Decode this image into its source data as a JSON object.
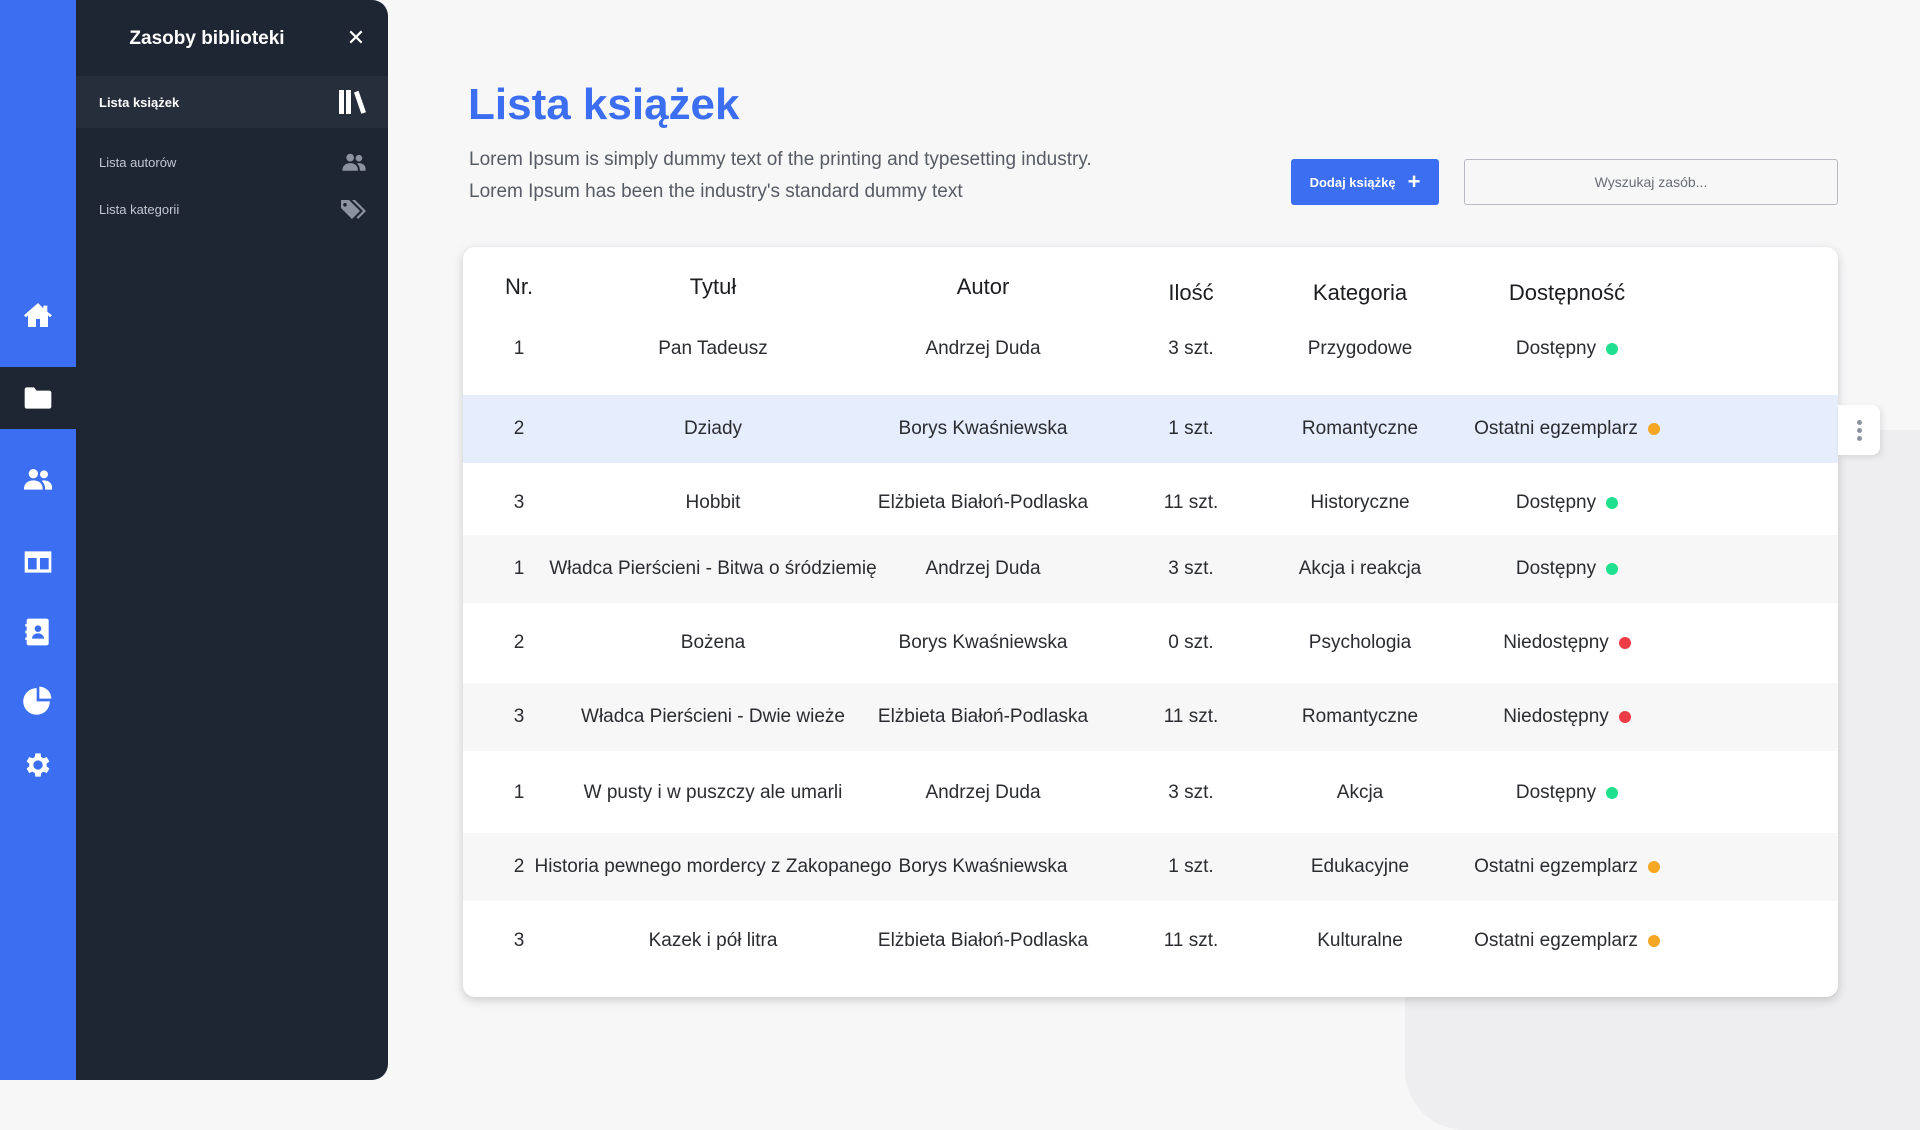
{
  "panel": {
    "title": "Zasoby biblioteki",
    "close_icon": "close-icon",
    "items": [
      {
        "label": "Lista książek",
        "icon": "books-icon",
        "active": true
      },
      {
        "label": "Lista autorów",
        "icon": "users-icon",
        "active": false
      },
      {
        "label": "Lista kategorii",
        "icon": "tags-icon",
        "active": false
      }
    ]
  },
  "rail": {
    "items": [
      {
        "icon": "home-icon",
        "active": false
      },
      {
        "icon": "folder-icon",
        "active": true
      },
      {
        "icon": "users-icon",
        "active": false
      },
      {
        "icon": "layout-icon",
        "active": false
      },
      {
        "icon": "contact-book-icon",
        "active": false
      },
      {
        "icon": "pie-chart-icon",
        "active": false
      },
      {
        "icon": "gear-icon",
        "active": false
      }
    ]
  },
  "main": {
    "title": "Lista książek",
    "description_line1": "Lorem Ipsum is simply dummy text of the printing and typesetting industry.",
    "description_line2": "Lorem Ipsum has been the industry's standard dummy text",
    "add_button_label": "Dodaj książkę",
    "search_placeholder": "Wyszukaj zasób..."
  },
  "table": {
    "headers": {
      "nr": "Nr.",
      "title": "Tytuł",
      "author": "Autor",
      "qty": "Ilość",
      "category": "Kategoria",
      "availability": "Dostępność"
    },
    "rows": [
      {
        "nr": "1",
        "title": "Pan Tadeusz",
        "author": "Andrzej Duda",
        "qty": "3 szt.",
        "category": "Przygodowe",
        "availability": "Dostępny",
        "status": "available"
      },
      {
        "nr": "2",
        "title": "Dziady",
        "author": "Borys Kwaśniewska",
        "qty": "1 szt.",
        "category": "Romantyczne",
        "availability": "Ostatni egzemplarz",
        "status": "last"
      },
      {
        "nr": "3",
        "title": "Hobbit",
        "author": "Elżbieta Białoń-Podlaska",
        "qty": "11 szt.",
        "category": "Historyczne",
        "availability": "Dostępny",
        "status": "available"
      },
      {
        "nr": "1",
        "title": "Władca Pierścieni - Bitwa o śródziemię",
        "author": "Andrzej Duda",
        "qty": "3 szt.",
        "category": "Akcja i reakcja",
        "availability": "Dostępny",
        "status": "available"
      },
      {
        "nr": "2",
        "title": "Bożena",
        "author": "Borys Kwaśniewska",
        "qty": "0 szt.",
        "category": "Psychologia",
        "availability": "Niedostępny",
        "status": "unavailable"
      },
      {
        "nr": "3",
        "title": "Władca Pierścieni - Dwie wieże",
        "author": "Elżbieta Białoń-Podlaska",
        "qty": "11 szt.",
        "category": "Romantyczne",
        "availability": "Niedostępny",
        "status": "unavailable"
      },
      {
        "nr": "1",
        "title": "W pusty i w puszczy ale umarli",
        "author": "Andrzej Duda",
        "qty": "3 szt.",
        "category": "Akcja",
        "availability": "Dostępny",
        "status": "available"
      },
      {
        "nr": "2",
        "title": "Historia pewnego mordercy z Zakopanego",
        "author": "Borys Kwaśniewska",
        "qty": "1 szt.",
        "category": "Edukacyjne",
        "availability": "Ostatni egzemplarz",
        "status": "last"
      },
      {
        "nr": "3",
        "title": "Kazek i pół litra",
        "author": "Elżbieta Białoń-Podlaska",
        "qty": "11 szt.",
        "category": "Kulturalne",
        "availability": "Ostatni egzemplarz",
        "status": "last"
      }
    ],
    "selected_row": 1,
    "row_menu_icon": "more-vertical-icon"
  },
  "colors": {
    "accent": "#3b6ef0",
    "panel_bg": "#1e2533",
    "available": "#1fe08e",
    "last": "#f5a623",
    "unavailable": "#ee3b48"
  }
}
